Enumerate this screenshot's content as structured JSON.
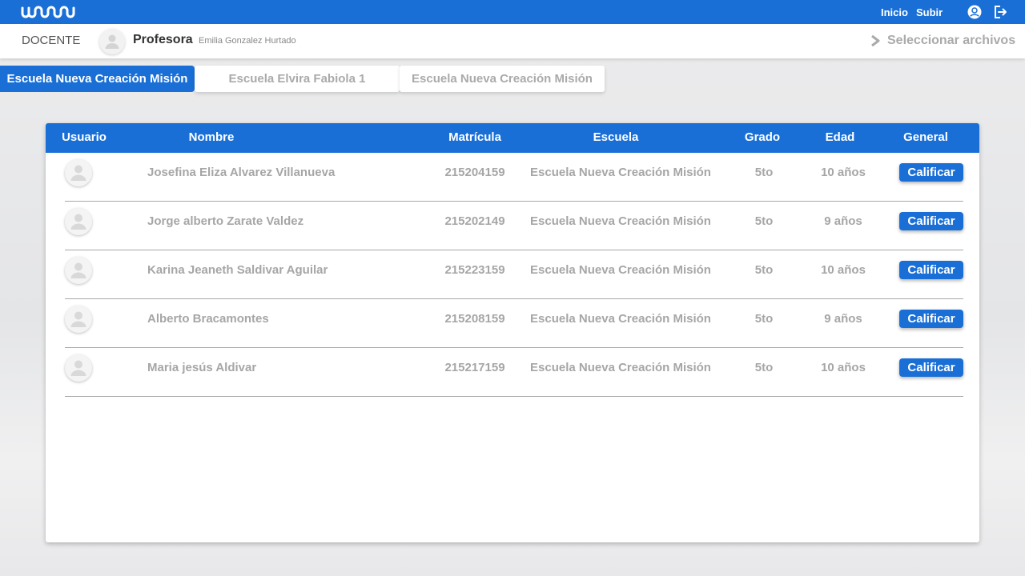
{
  "app": {
    "logo_icon": "brand-logo-icon",
    "nav": {
      "inicio": "Inicio",
      "subir": "Subir"
    },
    "icons": [
      "user-circle-icon",
      "logout-icon"
    ]
  },
  "header": {
    "role": "DOCENTE",
    "title": "Profesora",
    "teacher_name": "Emilia Gonzalez Hurtado",
    "select_files": "Seleccionar archivos"
  },
  "tabs": [
    {
      "label": "Escuela Nueva Creación Misión",
      "active": true
    },
    {
      "label": "Escuela Elvira Fabiola 1",
      "active": false
    },
    {
      "label": "Escuela Nueva Creación Misión",
      "active": false
    }
  ],
  "table": {
    "columns": [
      "Usuario",
      "Nombre",
      "Matrícula",
      "Escuela",
      "Grado",
      "Edad",
      "General"
    ],
    "rows": [
      {
        "nombre": "Josefina Eliza Alvarez Villanueva",
        "matricula": "215204159",
        "escuela": "Escuela Nueva Creación Misión",
        "grado": "5to",
        "edad": "10 años",
        "action": "Calificar"
      },
      {
        "nombre": "Jorge alberto Zarate Valdez",
        "matricula": "215202149",
        "escuela": "Escuela Nueva Creación Misión",
        "grado": "5to",
        "edad": "9 años",
        "action": "Calificar"
      },
      {
        "nombre": "Karina Jeaneth Saldivar Aguilar",
        "matricula": "215223159",
        "escuela": "Escuela Nueva Creación Misión",
        "grado": "5to",
        "edad": "10 años",
        "action": "Calificar"
      },
      {
        "nombre": "Alberto Bracamontes",
        "matricula": "215208159",
        "escuela": "Escuela Nueva Creación Misión",
        "grado": "5to",
        "edad": "9 años",
        "action": "Calificar"
      },
      {
        "nombre": "Maria jesús Aldivar",
        "matricula": "215217159",
        "escuela": "Escuela Nueva Creación Misión",
        "grado": "5to",
        "edad": "10 años",
        "action": "Calificar"
      }
    ]
  },
  "colors": {
    "primary": "#1a6fd6",
    "muted_text": "#a6a6a6",
    "white": "#ffffff"
  }
}
